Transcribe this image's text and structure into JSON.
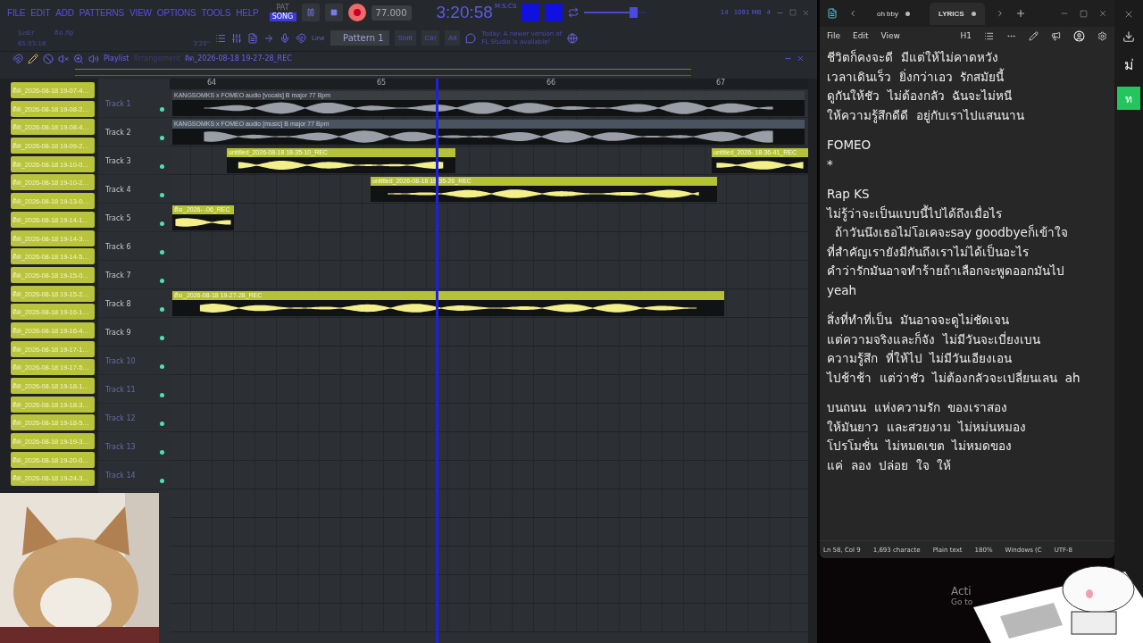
{
  "menu": [
    "FILE",
    "EDIT",
    "ADD",
    "PATTERNS",
    "VIEW",
    "OPTIONS",
    "TOOLS",
    "HELP"
  ],
  "mode_switch": [
    {
      "label": "PAT",
      "selected": false
    },
    {
      "label": "SONG",
      "selected": true
    }
  ],
  "transport": {
    "recording": true,
    "tempo": "77.000",
    "time": "3:20:58",
    "time_unit": "M:S:CS"
  },
  "hint": {
    "user": "]usEr",
    "file": "ดิด.flp",
    "position": "65:03:18",
    "length": "3'20\""
  },
  "volume": {
    "level": 0.78
  },
  "snap": "Line",
  "pattern": "Pattern 1",
  "modifiers": [
    "Shift",
    "Ctrl",
    "Alt"
  ],
  "news": "Today: A newer version of FL Studio is available!",
  "monitor": {
    "cpu": "14",
    "memory": "1091 MB",
    "polyphony": "4"
  },
  "playlist": {
    "title": "Playlist",
    "view": "Arrangement",
    "clip_name": "ดิด_2026-08-18 19-27-28_REC",
    "ruler": [
      "64",
      "65",
      "66",
      "67"
    ],
    "tracks": [
      {
        "label": "Track 1",
        "faded": true,
        "clips": [
          {
            "name": "KANGSOMKS x FOMEO audio [vocals] B major 77 Bpm",
            "kind": "audio",
            "color": "#3a3d42"
          }
        ]
      },
      {
        "label": "Track 2",
        "faded": false,
        "clips": [
          {
            "name": "KANGSOMKS x FOMEO audio [music] B major 77 Bpm",
            "kind": "audio",
            "color": "#4a5360"
          }
        ]
      },
      {
        "label": "Track 3",
        "faded": false,
        "clips": [
          {
            "name": "untitled_2026-08-18 18-35-10_REC",
            "kind": "recording",
            "color": "#b5c235"
          },
          {
            "name": "untitled_2026-  18-36-41_REC",
            "kind": "recording",
            "color": "#b5c235"
          }
        ]
      },
      {
        "label": "Track 4",
        "faded": false,
        "clips": [
          {
            "name": "untitled_2026-08-18 18-35-26_REC",
            "kind": "recording",
            "color": "#b5c235"
          }
        ]
      },
      {
        "label": "Track 5",
        "faded": false,
        "clips": [
          {
            "name": "ดิด_2026-  -06_REC",
            "kind": "recording",
            "color": "#b5c235"
          }
        ]
      },
      {
        "label": "Track 6",
        "faded": false
      },
      {
        "label": "Track 7",
        "faded": false
      },
      {
        "label": "Track 8",
        "faded": false,
        "clips": [
          {
            "name": "ดิด_2026-08-18 19-27-28_REC",
            "kind": "recording",
            "color": "#b5c235"
          }
        ]
      },
      {
        "label": "Track 9",
        "faded": false
      },
      {
        "label": "Track 10",
        "faded": true
      },
      {
        "label": "Track 11",
        "faded": true
      },
      {
        "label": "Track 12",
        "faded": true
      },
      {
        "label": "Track 13",
        "faded": true
      },
      {
        "label": "Track 14",
        "faded": true
      }
    ]
  },
  "browser_clips": [
    "ดิด_2026-08-18 19-07-4…",
    "ดิด_2026-08-18 19-08-2…",
    "ดิด_2026-08-18 19-08-4…",
    "ดิด_2026-08-18 19-09-2…",
    "ดิด_2026-08-18 19-10-0…",
    "ดิด_2026-08-18 19-10-2…",
    "ดิด_2026-08-18 19-13-0…",
    "ดิด_2026-08-18 19-14-1…",
    "ดิด_2026-08-18 19-14-3…",
    "ดิด_2026-08-18 19-14-5…",
    "ดิด_2026-08-18 19-15-0…",
    "ดิด_2026-08-18 19-15-2…",
    "ดิด_2026-08-18 19-16-1…",
    "ดิด_2026-08-18 19-16-4…",
    "ดิด_2026-08-18 19-17-1…",
    "ดิด_2026-08-18 19-17-5…",
    "ดิด_2026-08-18 19-18-1…",
    "ดิด_2026-08-18 19-18-3…",
    "ดิด_2026-08-18 19-18-5…",
    "ดิด_2026-08-18 19-19-3…",
    "ดิด_2026-08-18 19-20-0…",
    "ดิด_2026-08-18 19-24-3…"
  ],
  "notepad": {
    "tabs": [
      {
        "label": "oh bby",
        "selected": false
      },
      {
        "label": "LYRICS",
        "selected": true
      }
    ],
    "menu": [
      "File",
      "Edit",
      "View"
    ],
    "heading": "H1",
    "stanzas": [
      [
        "ชีวิตก็คงจะดี  มีแต่ให้ไม่คาดหวัง",
        "เวลาเดินเร็ว  ยิ่งกว่าเอว  รักสมัยนี้",
        "ดูกันให้ชัว  ไม่ต้องกลัว  ฉันจะไม่หนี",
        "ให้ความรู้สึกดีดี  อยู่กับเราไปแสนนาน"
      ],
      [
        "FOMEO",
        "*"
      ],
      [
        "Rap KS",
        "ไม่รู้ว่าจะเป็นแบบนี้ไปได้ถึงเมื่อไร",
        "  ถ้าวันนึงเธอไม่โอเคจะsay goodbyeก็เข้าใจ",
        "ที่สำคัญเรายังมีกันถึงเราไม่ได้เป็นอะไร",
        "คำว่ารักมันอาจทำร้ายถ้าเลือกจะพูดออกมันไป",
        "yeah"
      ],
      [
        "สิ่งที่ทำที่เป็น  มันอาจจะดูไม่ชัดเจน",
        "แต่ความจริงและก็จัง  ไม่มีวันจะเบี่ยงเบน",
        "ความรู้สึก  ที่ให้ไป  ไม่มีวันเอียงเอน",
        "ไปช้าช้า  แต่ว่าชัว  ไม่ต้องกลัวจะเปลี่ยนเลน  ah"
      ],
      [
        "บนถนน  แห่งความรัก  ของเราสอง",
        "ให้มันยาว  และสวยงาม  ไม่หม่นหมอง",
        "โปรโมชั่น  ไม่หมดเขต  ไม่หมดของ",
        "แค่  ลอง  ปล่อย  ใจ  ให้"
      ]
    ],
    "status": [
      "Ln 58, Col 9",
      "1,693 characte",
      "Plain text",
      "180%",
      "Windows (C",
      "UTF-8"
    ]
  },
  "desktop": {
    "activation": [
      "Acti",
      "Go to"
    ]
  },
  "side_window": {
    "text": "ม่",
    "button": "ท"
  }
}
